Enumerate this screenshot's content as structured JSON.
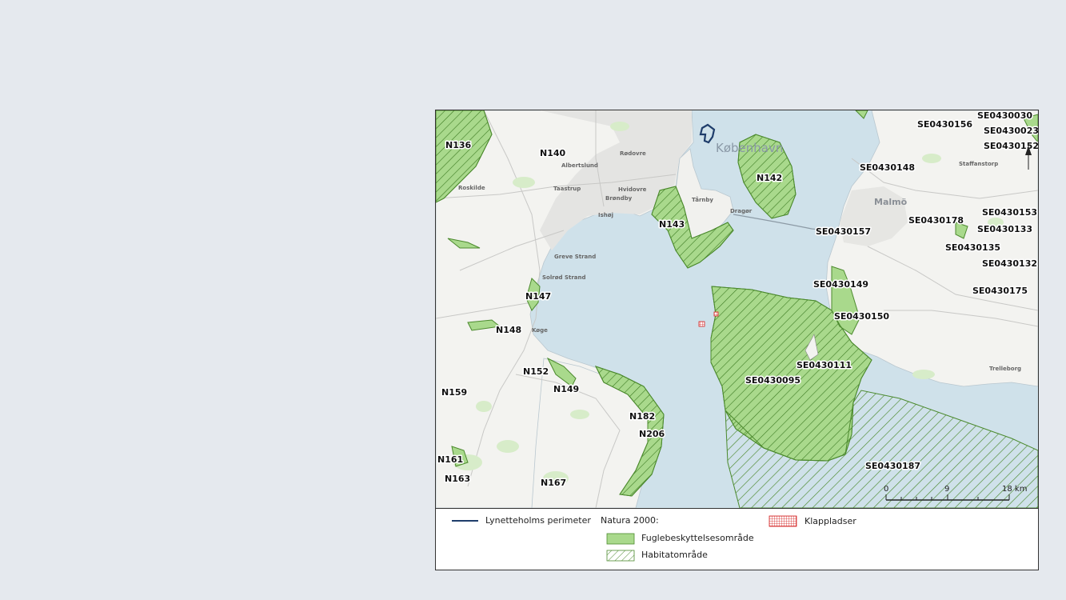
{
  "map": {
    "area_labels": [
      "N136",
      "N140",
      "N142",
      "N143",
      "N147",
      "N148",
      "N152",
      "N149",
      "N159",
      "N182",
      "N206",
      "N161",
      "N163",
      "N167",
      "SE0430030",
      "SE0430156",
      "SE0430023",
      "SE0430152",
      "SE0430148",
      "SE0430153",
      "SE0430178",
      "SE0430133",
      "SE0430157",
      "SE0430135",
      "SE0430132",
      "SE0430149",
      "SE0430175",
      "SE0430150",
      "SE0430111",
      "SE0430095",
      "SE0430187"
    ],
    "place_names": {
      "copenhagen": "København",
      "malmo": "Malmö",
      "greve": "Greve Strand",
      "solrod": "Solrød Strand",
      "koge": "Køge",
      "roskilde": "Roskilde",
      "albertslund": "Albertslund",
      "taastrup": "Taastrup",
      "hvidovre": "Hvidovre",
      "rodovre": "Rødovre",
      "brondby": "Brøndby",
      "ishoj": "Ishøj",
      "dragor": "Dragør",
      "tarnby": "Tårnby",
      "trelleborg": "Trelleborg",
      "staffanstorp": "Staffanstorp"
    },
    "scale": {
      "ticks": [
        "0",
        "9",
        "18 km"
      ]
    }
  },
  "legend": {
    "perimeter": "Lynetteholms perimeter",
    "natura_title": "Natura 2000:",
    "bird_area": "Fuglebeskyttelsesområde",
    "habitat_area": "Habitatområde",
    "dump_sites": "Klappladser"
  },
  "colors": {
    "sea": "#cfe1ea",
    "land": "#f4f4f1",
    "natura_green": "#a9d98c",
    "natura_stroke": "#4c8a2e",
    "perimeter": "#1f3d6b",
    "dump_red": "#d42020"
  }
}
